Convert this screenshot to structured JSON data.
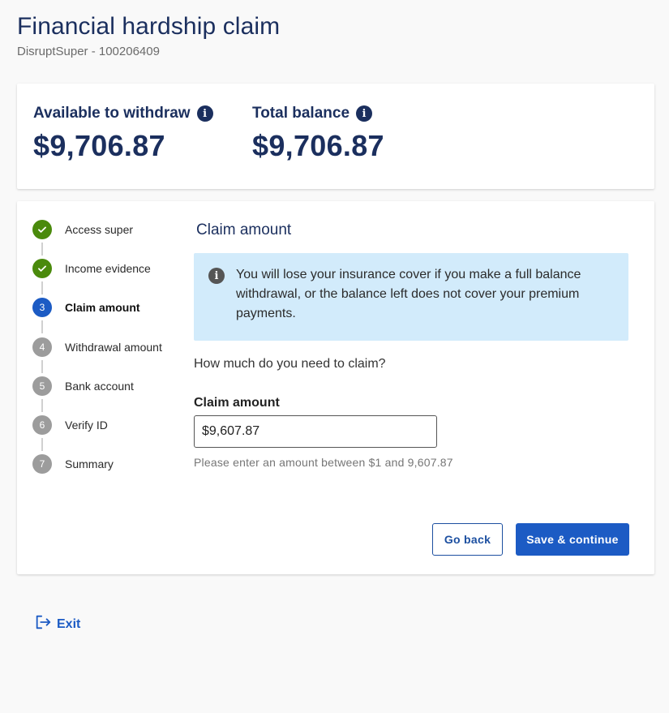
{
  "header": {
    "title": "Financial hardship claim",
    "subtitle": "DisruptSuper - 100206409"
  },
  "balances": {
    "available_label": "Available to withdraw",
    "available_amount": "$9,706.87",
    "total_label": "Total balance",
    "total_amount": "$9,706.87",
    "info_icon": "info-icon"
  },
  "stepper": {
    "steps": [
      {
        "number": "1",
        "label": "Access super",
        "state": "done"
      },
      {
        "number": "2",
        "label": "Income evidence",
        "state": "done"
      },
      {
        "number": "3",
        "label": "Claim amount",
        "state": "current"
      },
      {
        "number": "4",
        "label": "Withdrawal amount",
        "state": "todo"
      },
      {
        "number": "5",
        "label": "Bank account",
        "state": "todo"
      },
      {
        "number": "6",
        "label": "Verify ID",
        "state": "todo"
      },
      {
        "number": "7",
        "label": "Summary",
        "state": "todo"
      }
    ]
  },
  "form": {
    "section_title": "Claim amount",
    "alert_text": "You will lose your insurance cover if you make a full balance withdrawal, or the balance left does not cover your premium payments.",
    "question": "How much do you need to claim?",
    "field_label": "Claim amount",
    "field_value": "$9,607.87",
    "hint": "Please enter an amount between $1 and 9,607.87"
  },
  "actions": {
    "back_label": "Go back",
    "save_label": "Save & continue"
  },
  "exit": {
    "label": "Exit",
    "icon": "exit-icon"
  },
  "colors": {
    "primary": "#1c5bc4",
    "navy": "#1b2f5e",
    "done": "#4a8a0c",
    "todo": "#9c9c9c",
    "alert_bg": "#d2ebfb"
  }
}
